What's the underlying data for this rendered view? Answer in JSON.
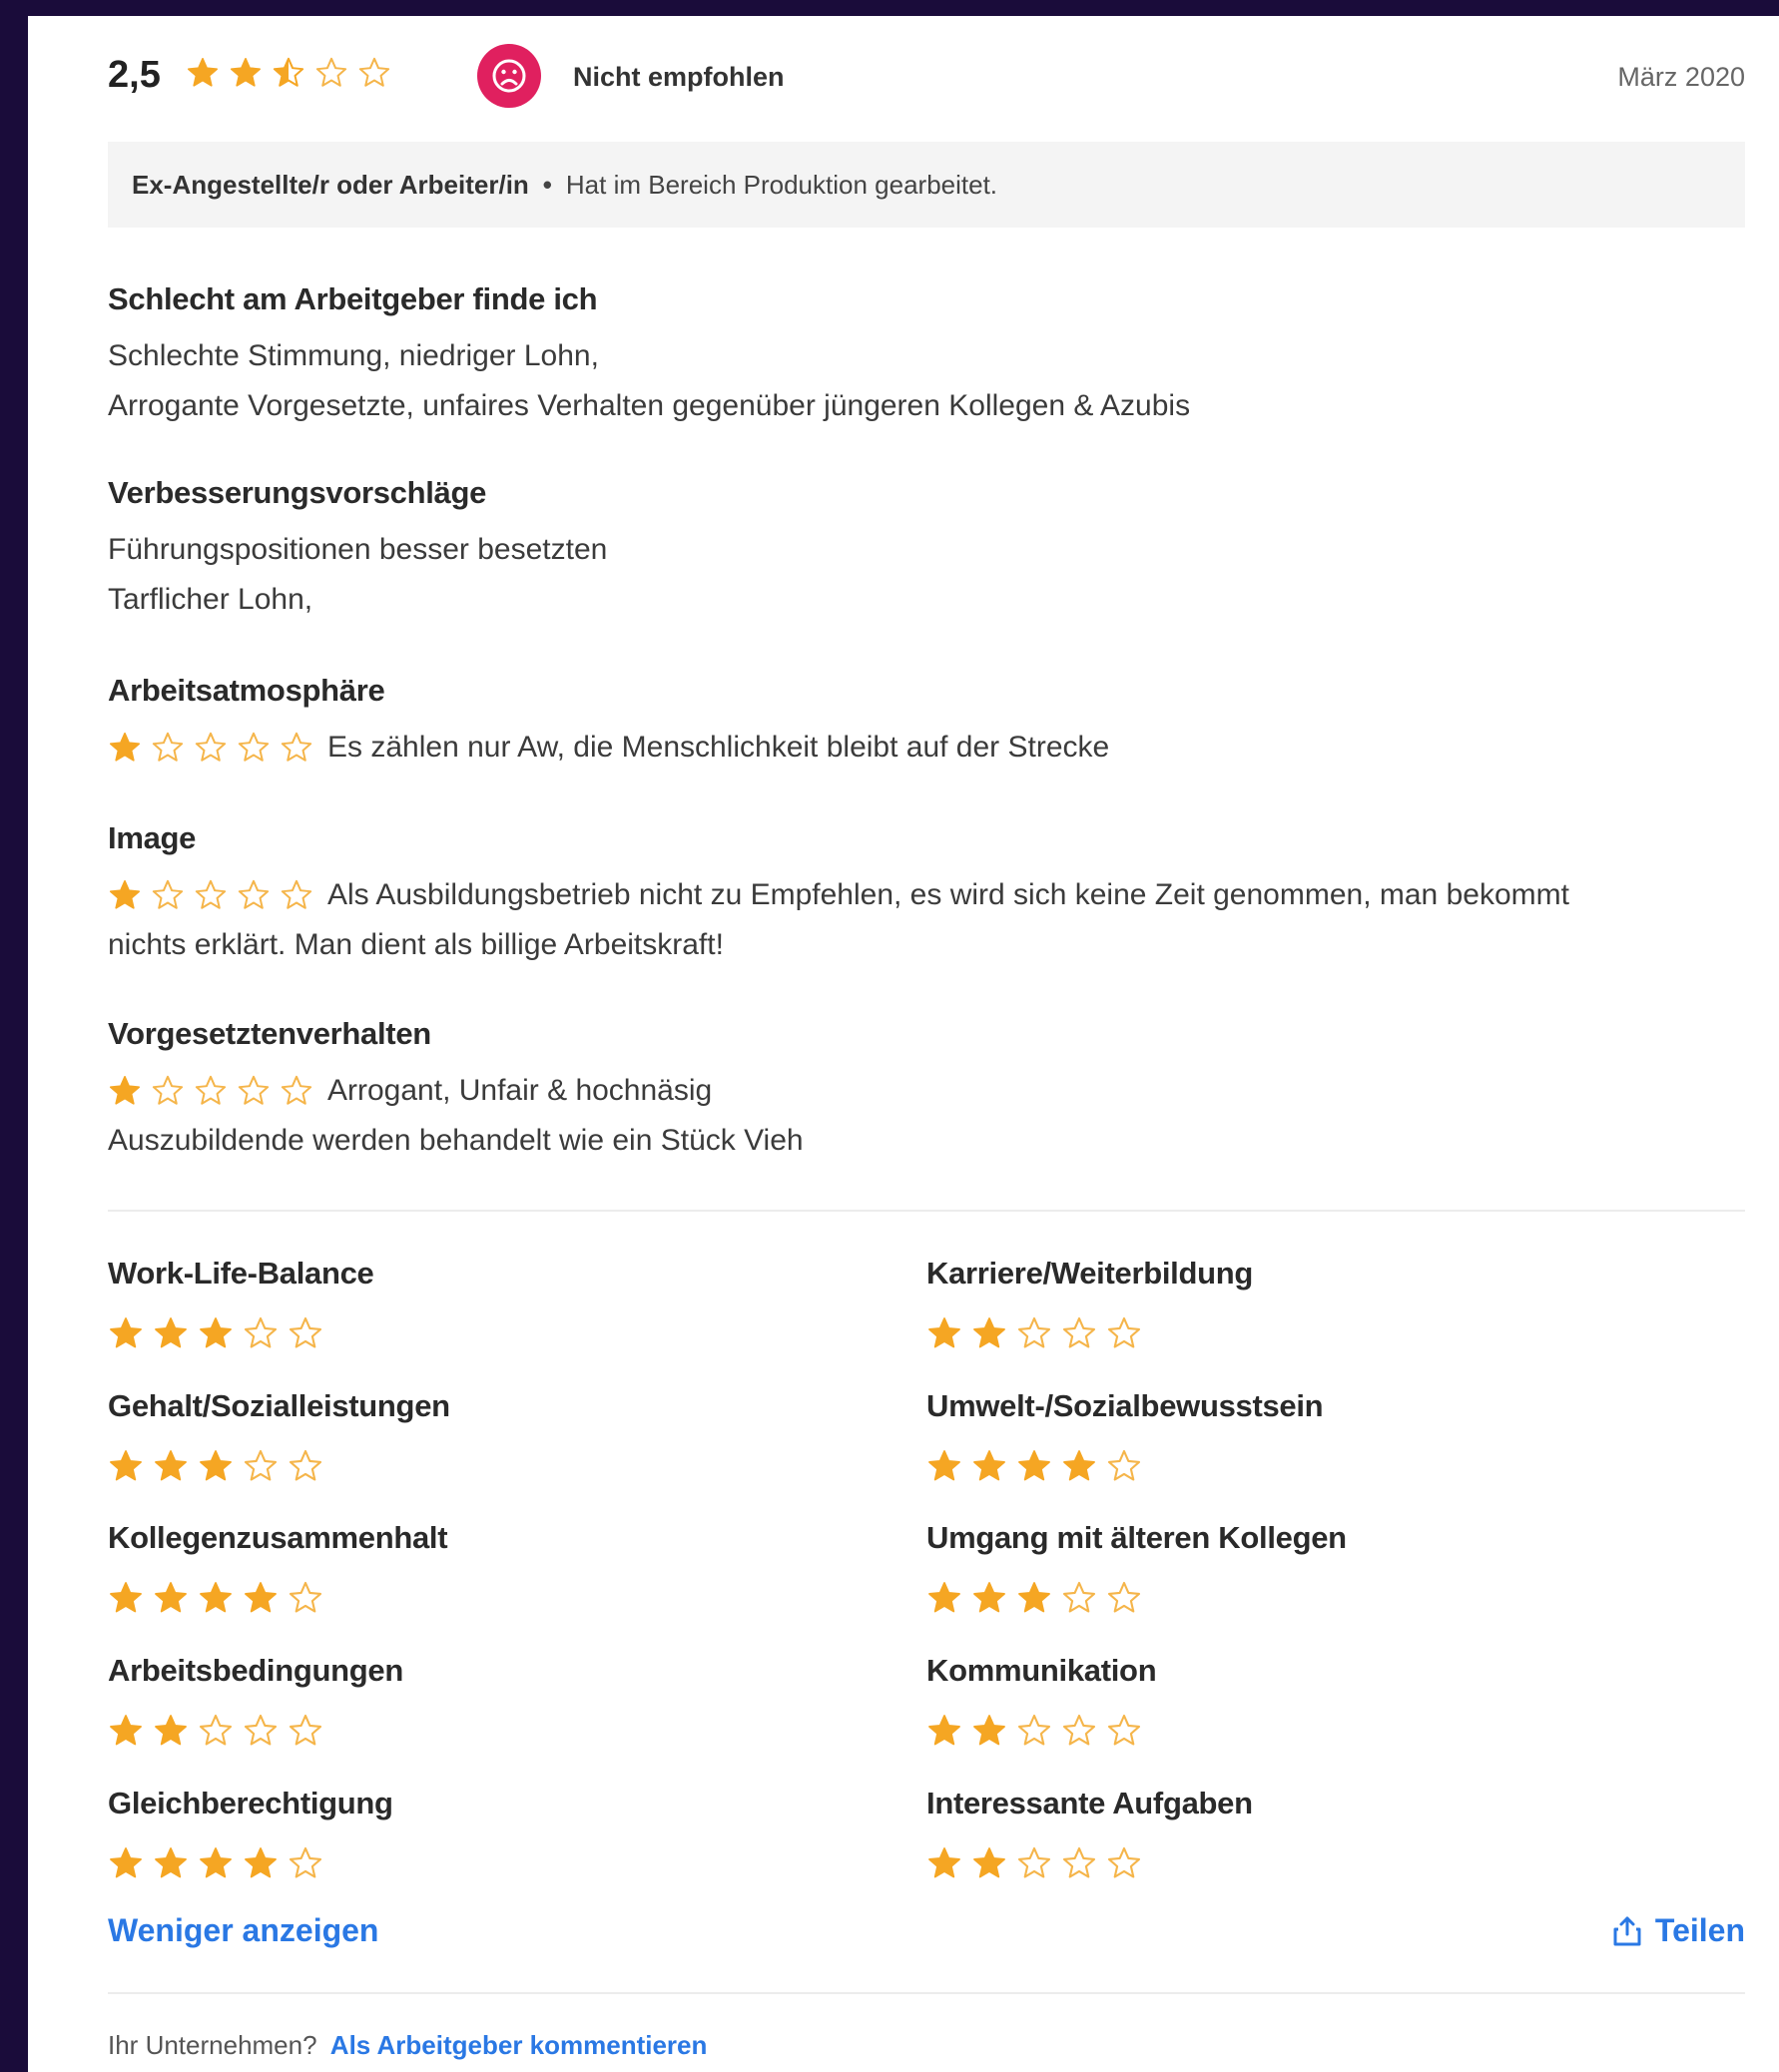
{
  "header": {
    "score": "2,5",
    "score_rating": 2.5,
    "recommendation_icon": "sad-face-icon",
    "recommendation": "Nicht empfohlen",
    "date": "März 2020"
  },
  "reviewer": {
    "role": "Ex-Angestellte/r oder Arbeiter/in",
    "separator": "•",
    "department": "Hat im Bereich Produktion gearbeitet."
  },
  "sections": {
    "bad": {
      "title": "Schlecht am Arbeitgeber finde ich",
      "lines": [
        "Schlechte Stimmung, niedriger Lohn,",
        "Arrogante Vorgesetzte, unfaires Verhalten gegenüber jüngeren Kollegen & Azubis"
      ]
    },
    "suggestions": {
      "title": "Verbesserungsvorschläge",
      "lines": [
        "Führungspositionen besser besetzten",
        "Tarflicher Lohn,"
      ]
    },
    "atmosphere": {
      "title": "Arbeitsatmosphäre",
      "rating": 1,
      "text": "Es zählen nur Aw, die Menschlichkeit bleibt auf der Strecke"
    },
    "image": {
      "title": "Image",
      "rating": 1,
      "text": "Als Ausbildungsbetrieb nicht zu Empfehlen, es wird sich keine Zeit genommen, man bekommt",
      "text2": "nichts erklärt. Man dient als billige Arbeitskraft!"
    },
    "supervisor": {
      "title": "Vorgesetztenverhalten",
      "rating": 1,
      "text": "Arrogant, Unfair & hochnäsig",
      "text2": "Auszubildende werden behandelt wie ein Stück Vieh"
    }
  },
  "ratings": [
    {
      "label": "Work-Life-Balance",
      "rating": 3
    },
    {
      "label": "Karriere/Weiterbildung",
      "rating": 2
    },
    {
      "label": "Gehalt/Sozialleistungen",
      "rating": 3
    },
    {
      "label": "Umwelt-/Sozialbewusstsein",
      "rating": 4
    },
    {
      "label": "Kollegenzusammenhalt",
      "rating": 4
    },
    {
      "label": "Umgang mit älteren Kollegen",
      "rating": 3
    },
    {
      "label": "Arbeitsbedingungen",
      "rating": 2
    },
    {
      "label": "Kommunikation",
      "rating": 2
    },
    {
      "label": "Gleichberechtigung",
      "rating": 4
    },
    {
      "label": "Interessante Aufgaben",
      "rating": 2
    }
  ],
  "actions": {
    "less": "Weniger anzeigen",
    "share": "Teilen",
    "share_icon": "share-icon"
  },
  "footer": {
    "question": "Ihr Unternehmen?",
    "link": "Als Arbeitgeber kommentieren"
  },
  "colors": {
    "star": "#f5a623",
    "star_empty_stroke": "#f5b54a",
    "sad_badge": "#e0205f",
    "link": "#2a78e4"
  }
}
